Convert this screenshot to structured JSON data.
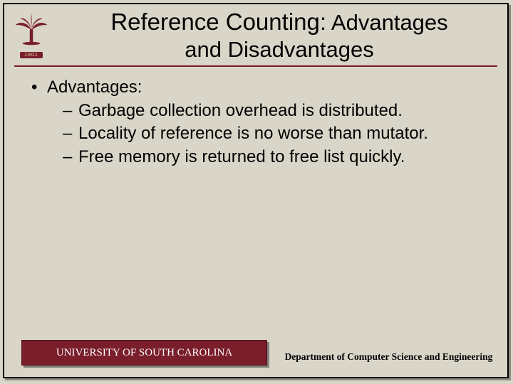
{
  "logo": {
    "year": "1801"
  },
  "title": {
    "line1": "Reference Counting:",
    "line1_small": " Advantages",
    "line2": "and Disadvantages"
  },
  "content": {
    "heading": "Advantages:",
    "items": [
      "Garbage collection overhead is distributed.",
      "Locality of reference is no worse than mutator.",
      "Free memory is returned to free list quickly."
    ]
  },
  "footer": {
    "university": "UNIVERSITY OF SOUTH CAROLINA",
    "department": "Department of Computer Science and Engineering"
  },
  "colors": {
    "garnet": "#7a1e2b",
    "bg": "#d9d5c8"
  }
}
